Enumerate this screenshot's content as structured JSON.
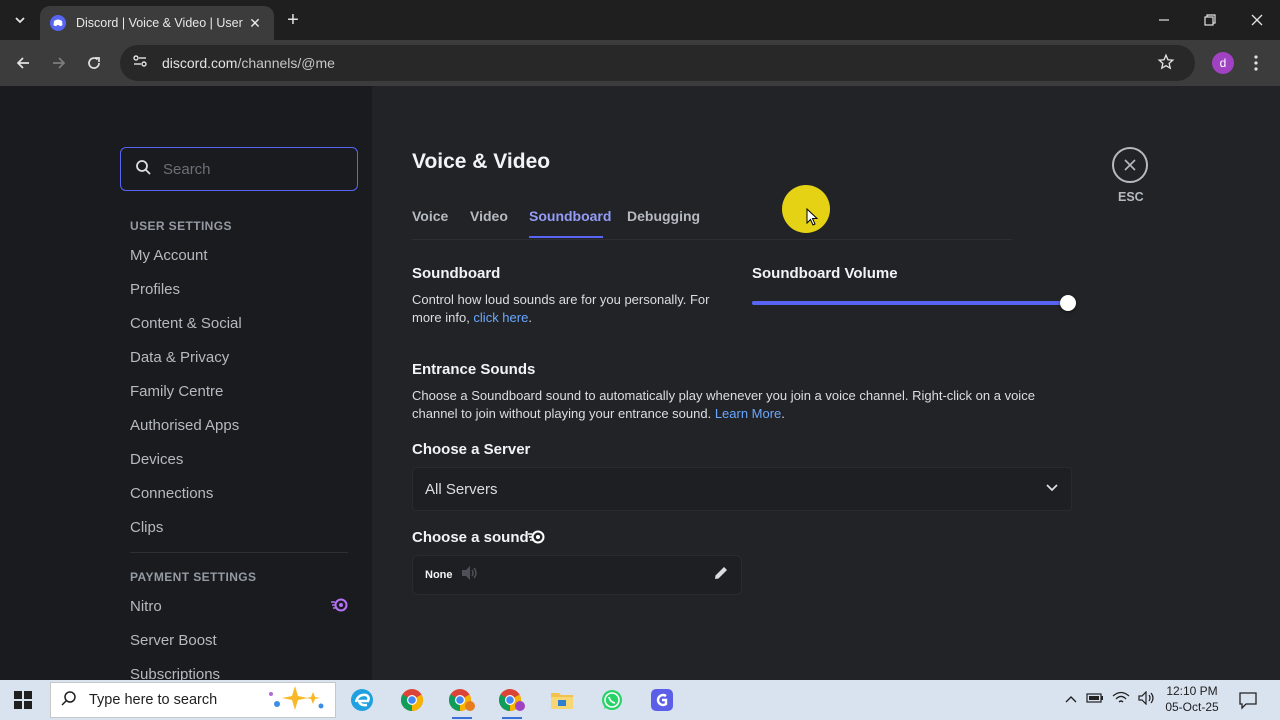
{
  "browser": {
    "tab_title": "Discord | Voice & Video | User Settings",
    "url_host": "discord.com",
    "url_path": "/channels/@me",
    "profile_initial": "d"
  },
  "sidebar": {
    "search_placeholder": "Search",
    "user_settings_header": "USER SETTINGS",
    "user_items": [
      "My Account",
      "Profiles",
      "Content & Social",
      "Data & Privacy",
      "Family Centre",
      "Authorised Apps",
      "Devices",
      "Connections",
      "Clips"
    ],
    "payment_settings_header": "PAYMENT SETTINGS",
    "payment_items": [
      "Nitro",
      "Server Boost",
      "Subscriptions"
    ]
  },
  "main": {
    "title": "Voice & Video",
    "tabs": [
      "Voice",
      "Video",
      "Soundboard",
      "Debugging"
    ],
    "active_tab": "Soundboard",
    "esc_label": "ESC",
    "soundboard": {
      "heading": "Soundboard",
      "desc_prefix": "Control how loud sounds are for you personally. For more info, ",
      "desc_link": "click here",
      "desc_suffix": ".",
      "volume_label": "Soundboard Volume",
      "volume_percent": 100
    },
    "entrance": {
      "heading": "Entrance Sounds",
      "desc_prefix": "Choose a Soundboard sound to automatically play whenever you join a voice channel. Right-click on a voice channel to join without playing your entrance sound. ",
      "desc_link": "Learn More",
      "desc_suffix": "."
    },
    "server": {
      "heading": "Choose a Server",
      "value": "All Servers"
    },
    "sound": {
      "heading": "Choose a sound",
      "value": "None"
    }
  },
  "taskbar": {
    "search_placeholder": "Type here to search",
    "time": "12:10 PM",
    "date": "05-Oct-25"
  },
  "colors": {
    "accent": "#5865f2",
    "link": "#6aa7ff",
    "nitro": "#b473f5"
  }
}
